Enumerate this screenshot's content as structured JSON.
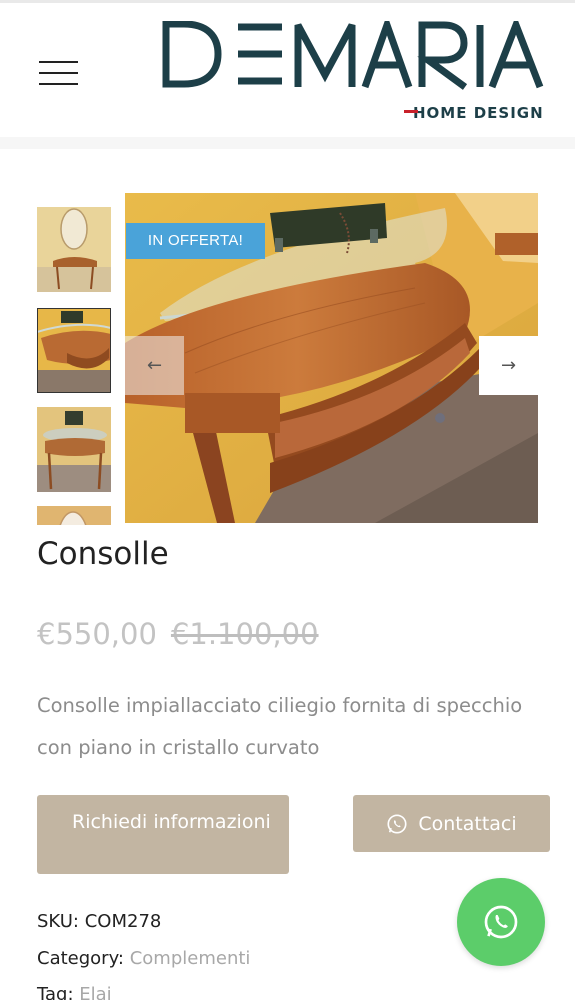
{
  "brand": {
    "logo_text": "DEMARIA",
    "logo_subtitle": "HOME DESIGN",
    "color": "#1d3f48",
    "accent": "#c8202a"
  },
  "header": {
    "menu_icon": "hamburger-menu-icon"
  },
  "gallery": {
    "badge": "IN OFFERTA!",
    "badge_color": "#4aa3d9",
    "prev_icon": "arrow-left-icon",
    "next_icon": "arrow-right-icon",
    "prev_glyph": "←",
    "next_glyph": "→",
    "thumbnail_count": 4
  },
  "product": {
    "title": "Consolle",
    "price": "€550,00",
    "old_price": "€1.100,00",
    "description": "Consolle impiallacciato ciliegio fornita di specchio con piano in cristallo curvato",
    "button_info": "Richiedi informazioni",
    "button_contact": "Contattaci",
    "button_color": "#c2b5a2",
    "sku_label": "SKU:",
    "sku": "COM278",
    "category_label": "Category:",
    "category": "Complementi",
    "tag_label": "Tag:",
    "tag": "Elai"
  },
  "floating": {
    "whatsapp_icon": "whatsapp-icon",
    "color": "#5ccd6a"
  }
}
